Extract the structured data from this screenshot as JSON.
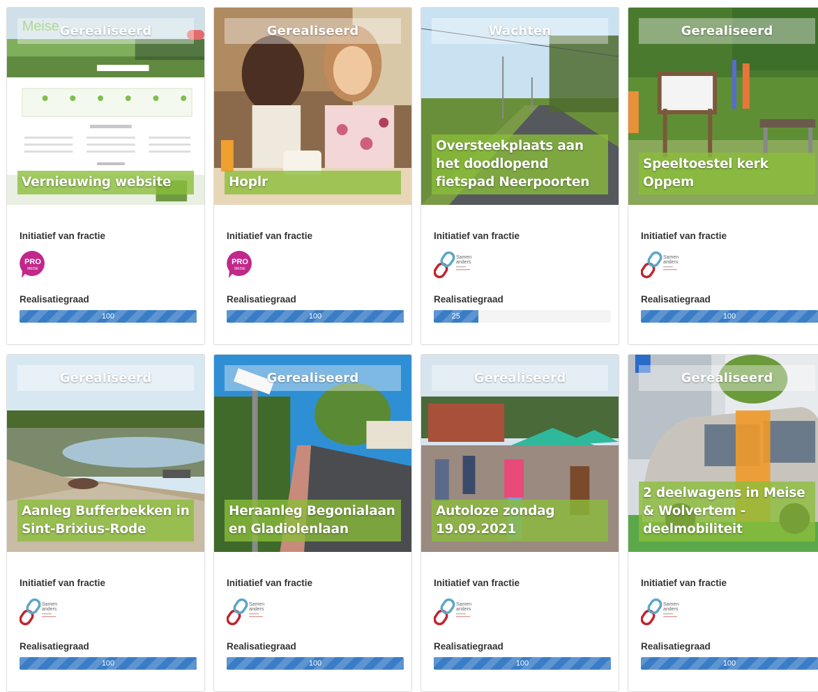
{
  "labels": {
    "initiative": "Initiatief van fractie",
    "progress": "Realisatiegraad"
  },
  "logos": {
    "pro": {
      "line1": "PRO",
      "line2": "MEISE",
      "color": "#c2278a"
    },
    "samen": {
      "line1": "Samen",
      "line2": "anders",
      "color_red": "#c0242f",
      "color_blue": "#5aa6c9"
    }
  },
  "cards": [
    {
      "status": "Gerealiseerd",
      "title": "Vernieuwing website",
      "party": "pro",
      "progress": 100,
      "progress_label": "100"
    },
    {
      "status": "Gerealiseerd",
      "title": "Hoplr",
      "party": "pro",
      "progress": 100,
      "progress_label": "100"
    },
    {
      "status": "Wachten",
      "title": "Oversteekplaats aan het doodlopend fietspad Neerpoorten",
      "party": "samen",
      "progress": 25,
      "progress_label": "25"
    },
    {
      "status": "Gerealiseerd",
      "title": "Speeltoestel kerk Oppem",
      "party": "samen",
      "progress": 100,
      "progress_label": "100"
    },
    {
      "status": "Gerealiseerd",
      "title": "Aanleg Bufferbekken in Sint-Brixius-Rode",
      "party": "samen",
      "progress": 100,
      "progress_label": "100"
    },
    {
      "status": "Gerealiseerd",
      "title": "Heraanleg Begonialaan en Gladiolenlaan",
      "party": "samen",
      "progress": 100,
      "progress_label": "100"
    },
    {
      "status": "Gerealiseerd",
      "title": "Autoloze zondag 19.09.2021",
      "party": "samen",
      "progress": 100,
      "progress_label": "100"
    },
    {
      "status": "Gerealiseerd",
      "title": "2 deelwagens in Meise & Wolvertem - deelmobiliteit",
      "party": "samen",
      "progress": 100,
      "progress_label": "100"
    }
  ],
  "colors": {
    "title_overlay": "#8abe3a",
    "progress_bar": "#3a7dc6"
  }
}
